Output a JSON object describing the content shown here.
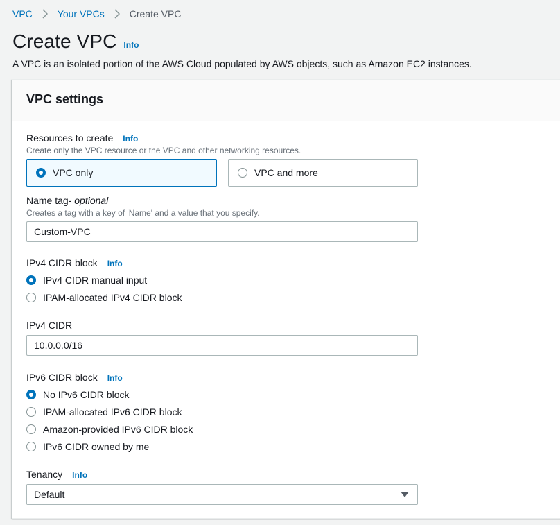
{
  "breadcrumb": {
    "items": [
      "VPC",
      "Your VPCs"
    ],
    "current": "Create VPC"
  },
  "header": {
    "title": "Create VPC",
    "info": "Info",
    "description": "A VPC is an isolated portion of the AWS Cloud populated by AWS objects, such as Amazon EC2 instances."
  },
  "panel": {
    "title": "VPC settings"
  },
  "resources": {
    "label": "Resources to create",
    "info": "Info",
    "description": "Create only the VPC resource or the VPC and other networking resources.",
    "options": [
      {
        "label": "VPC only",
        "selected": true
      },
      {
        "label": "VPC and more",
        "selected": false
      }
    ]
  },
  "name_tag": {
    "label": "Name tag",
    "optional": " - optional",
    "description": "Creates a tag with a key of 'Name' and a value that you specify.",
    "value": "Custom-VPC"
  },
  "ipv4_block": {
    "label": "IPv4 CIDR block",
    "info": "Info",
    "options": [
      {
        "label": "IPv4 CIDR manual input",
        "selected": true
      },
      {
        "label": "IPAM-allocated IPv4 CIDR block",
        "selected": false
      }
    ]
  },
  "ipv4_cidr": {
    "label": "IPv4 CIDR",
    "value": "10.0.0.0/16"
  },
  "ipv6_block": {
    "label": "IPv6 CIDR block",
    "info": "Info",
    "options": [
      {
        "label": "No IPv6 CIDR block",
        "selected": true
      },
      {
        "label": "IPAM-allocated IPv6 CIDR block",
        "selected": false
      },
      {
        "label": "Amazon-provided IPv6 CIDR block",
        "selected": false
      },
      {
        "label": "IPv6 CIDR owned by me",
        "selected": false
      }
    ]
  },
  "tenancy": {
    "label": "Tenancy",
    "info": "Info",
    "value": "Default"
  },
  "colors": {
    "link": "#0073bb",
    "selected_bg": "#f1faff",
    "border": "#aab7b8",
    "page_bg": "#f2f3f3"
  },
  "icons": [
    "chevron-right-icon",
    "radio-icon",
    "caret-down-icon"
  ]
}
